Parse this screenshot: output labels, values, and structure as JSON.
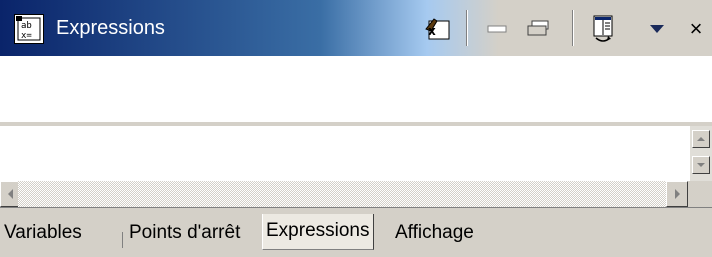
{
  "window": {
    "title": "Expressions"
  },
  "toolbar": {
    "icons": [
      "add-expression-icon",
      "minimize-icon",
      "restore-icon",
      "toggle-layout-icon",
      "dropdown-arrow-icon",
      "close-icon"
    ],
    "close_label": "×"
  },
  "tabs": [
    {
      "label": "Variables",
      "active": false
    },
    {
      "label": "Points d'arrêt",
      "active": false
    },
    {
      "label": "Expressions",
      "active": true
    },
    {
      "label": "Affichage",
      "active": false
    }
  ],
  "colors": {
    "title_gradient_start": "#0a246a",
    "title_gradient_mid": "#3a6ea5",
    "face": "#d4d0c8"
  }
}
